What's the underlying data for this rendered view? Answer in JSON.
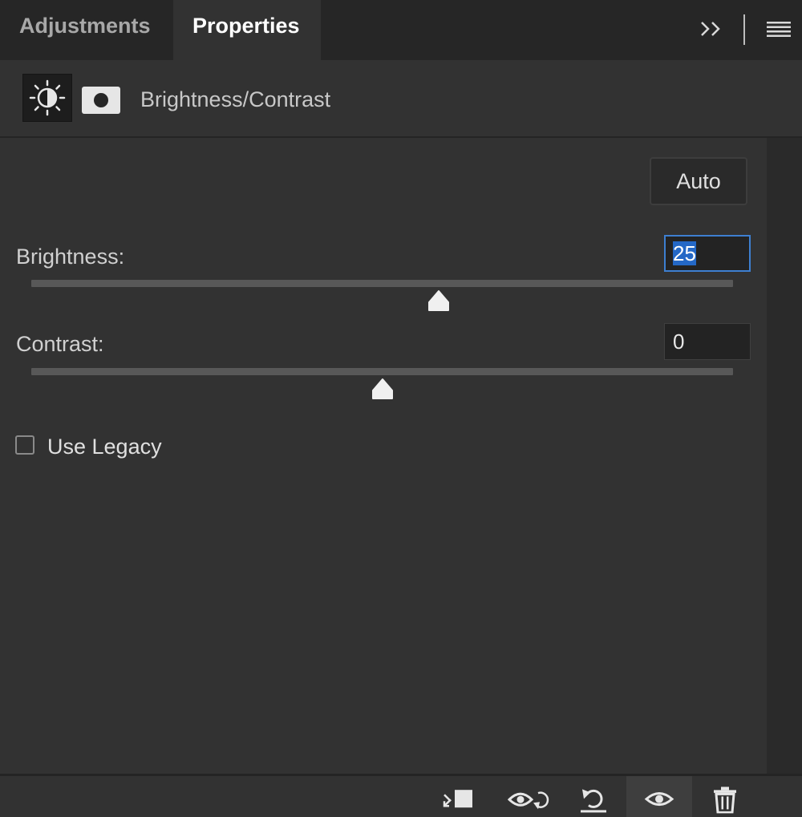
{
  "tabs": [
    {
      "label": "Adjustments",
      "active": false
    },
    {
      "label": "Properties",
      "active": true
    }
  ],
  "header": {
    "adjustment_icon": "brightness-contrast-icon",
    "mask_icon": "layer-mask-icon",
    "title": "Brightness/Contrast"
  },
  "controls": {
    "auto_label": "Auto",
    "brightness": {
      "label": "Brightness:",
      "value": "25",
      "slider_level": 0.58,
      "range": [
        -150,
        150
      ]
    },
    "contrast": {
      "label": "Contrast:",
      "value": "0",
      "slider_level": 0.5,
      "range": [
        -50,
        100
      ]
    },
    "legacy": {
      "label": "Use Legacy",
      "checked": false
    }
  },
  "footer_icons": [
    "clip-to-layer-icon",
    "view-previous-state-icon",
    "reset-icon",
    "visibility-icon",
    "delete-icon"
  ],
  "colors": {
    "panel_bg": "#323232",
    "tabbar_bg": "#262626",
    "focus_accent": "#3d7fd1",
    "selection": "#2468c6"
  }
}
